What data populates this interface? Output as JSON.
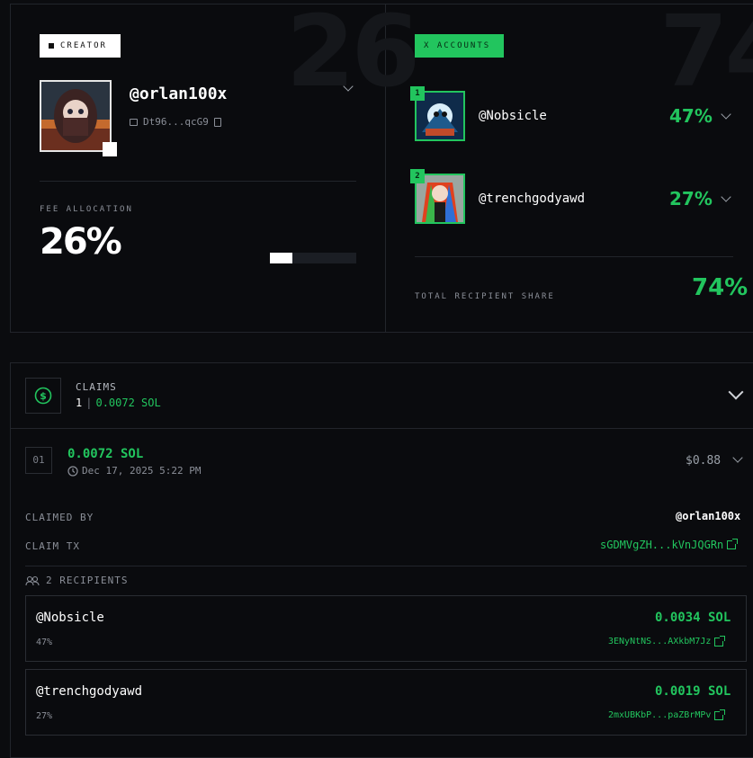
{
  "creator": {
    "bg_number": "26",
    "tag": "CREATOR",
    "name": "@orlan100x",
    "address": "Dt96...qcG9",
    "fee_label": "FEE ALLOCATION",
    "fee_value": "26%",
    "fee_fraction": 0.26
  },
  "accounts": {
    "bg_number": "74",
    "tag": "X ACCOUNTS",
    "items": [
      {
        "rank": "1",
        "name": "@Nobsicle",
        "pct": "47%"
      },
      {
        "rank": "2",
        "name": "@trenchgodyawd",
        "pct": "27%"
      }
    ],
    "total_label": "TOTAL RECIPIENT SHARE",
    "total_value": "74%"
  },
  "claims": {
    "title": "CLAIMS",
    "count": "1",
    "total": "0.0072 SOL",
    "entry": {
      "index": "01",
      "amount": "0.0072 SOL",
      "date": "Dec 17, 2025 5:22 PM",
      "usd": "$0.88",
      "claimed_by_label": "CLAIMED BY",
      "claimed_by": "@orlan100x",
      "claim_tx_label": "CLAIM TX",
      "claim_tx": "sGDMVgZH...kVnJQGRn",
      "recipients_label": "2 RECIPIENTS",
      "recipients": [
        {
          "name": "@Nobsicle",
          "pct": "47%",
          "sol": "0.0034 SOL",
          "addr": "3ENyNtNS...AXkbM7Jz"
        },
        {
          "name": "@trenchgodyawd",
          "pct": "27%",
          "sol": "0.0019 SOL",
          "addr": "2mxUBKbP...paZBrMPv"
        }
      ]
    }
  },
  "colors": {
    "accent": "#22c55e",
    "background": "#0b0c0f",
    "border": "#22252b"
  }
}
